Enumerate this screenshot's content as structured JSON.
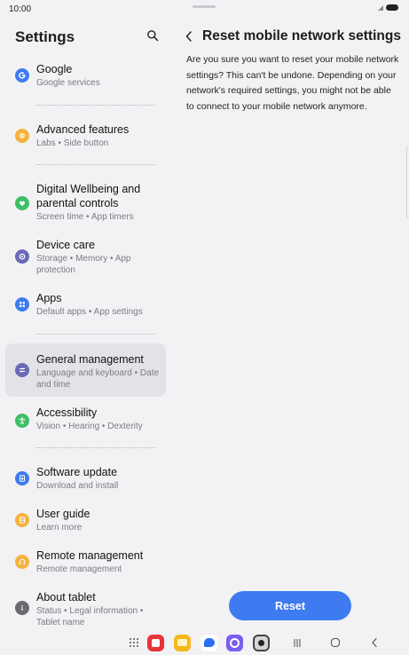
{
  "status_bar": {
    "time": "10:00"
  },
  "settings": {
    "title": "Settings",
    "items": [
      {
        "label": "Google",
        "sub": "Google services",
        "color": "#3e7bf0",
        "icon": "google-icon"
      },
      {
        "label": "Advanced features",
        "sub": "Labs • Side button",
        "color": "#f5b23c",
        "icon": "advanced-features-icon"
      },
      {
        "label": "Digital Wellbeing and parental controls",
        "sub": "Screen time • App timers",
        "color": "#3fbf66",
        "icon": "digital-wellbeing-icon"
      },
      {
        "label": "Device care",
        "sub": "Storage • Memory • App protection",
        "color": "#6a6ab5",
        "icon": "device-care-icon"
      },
      {
        "label": "Apps",
        "sub": "Default apps • App settings",
        "color": "#3e7bf0",
        "icon": "apps-icon"
      },
      {
        "label": "General management",
        "sub": "Language and keyboard • Date and time",
        "color": "#6a6ab5",
        "icon": "general-management-icon"
      },
      {
        "label": "Accessibility",
        "sub": "Vision • Hearing • Dexterity",
        "color": "#3fbf66",
        "icon": "accessibility-icon"
      },
      {
        "label": "Software update",
        "sub": "Download and install",
        "color": "#3e7bf0",
        "icon": "software-update-icon"
      },
      {
        "label": "User guide",
        "sub": "Learn more",
        "color": "#f5b23c",
        "icon": "user-guide-icon"
      },
      {
        "label": "Remote management",
        "sub": "Remote management",
        "color": "#f5b23c",
        "icon": "remote-management-icon"
      },
      {
        "label": "About tablet",
        "sub": "Status • Legal information • Tablet name",
        "color": "#6a6a72",
        "icon": "about-tablet-icon"
      }
    ],
    "active_item": "General management"
  },
  "detail": {
    "title": "Reset mobile network settings",
    "body": "Are you sure you want to reset your mobile network settings? This can't be undone. Depending on your network's required settings, you might not be able to connect to your mobile network anymore.",
    "reset_label": "Reset",
    "accent": "#3e7bf0"
  },
  "nav_bar": {
    "apps": [
      "app-drawer-icon",
      "flipboard-icon",
      "my-files-icon",
      "messages-icon",
      "internet-icon",
      "camera-icon"
    ],
    "buttons": [
      "recents-icon",
      "home-icon",
      "back-icon"
    ]
  }
}
